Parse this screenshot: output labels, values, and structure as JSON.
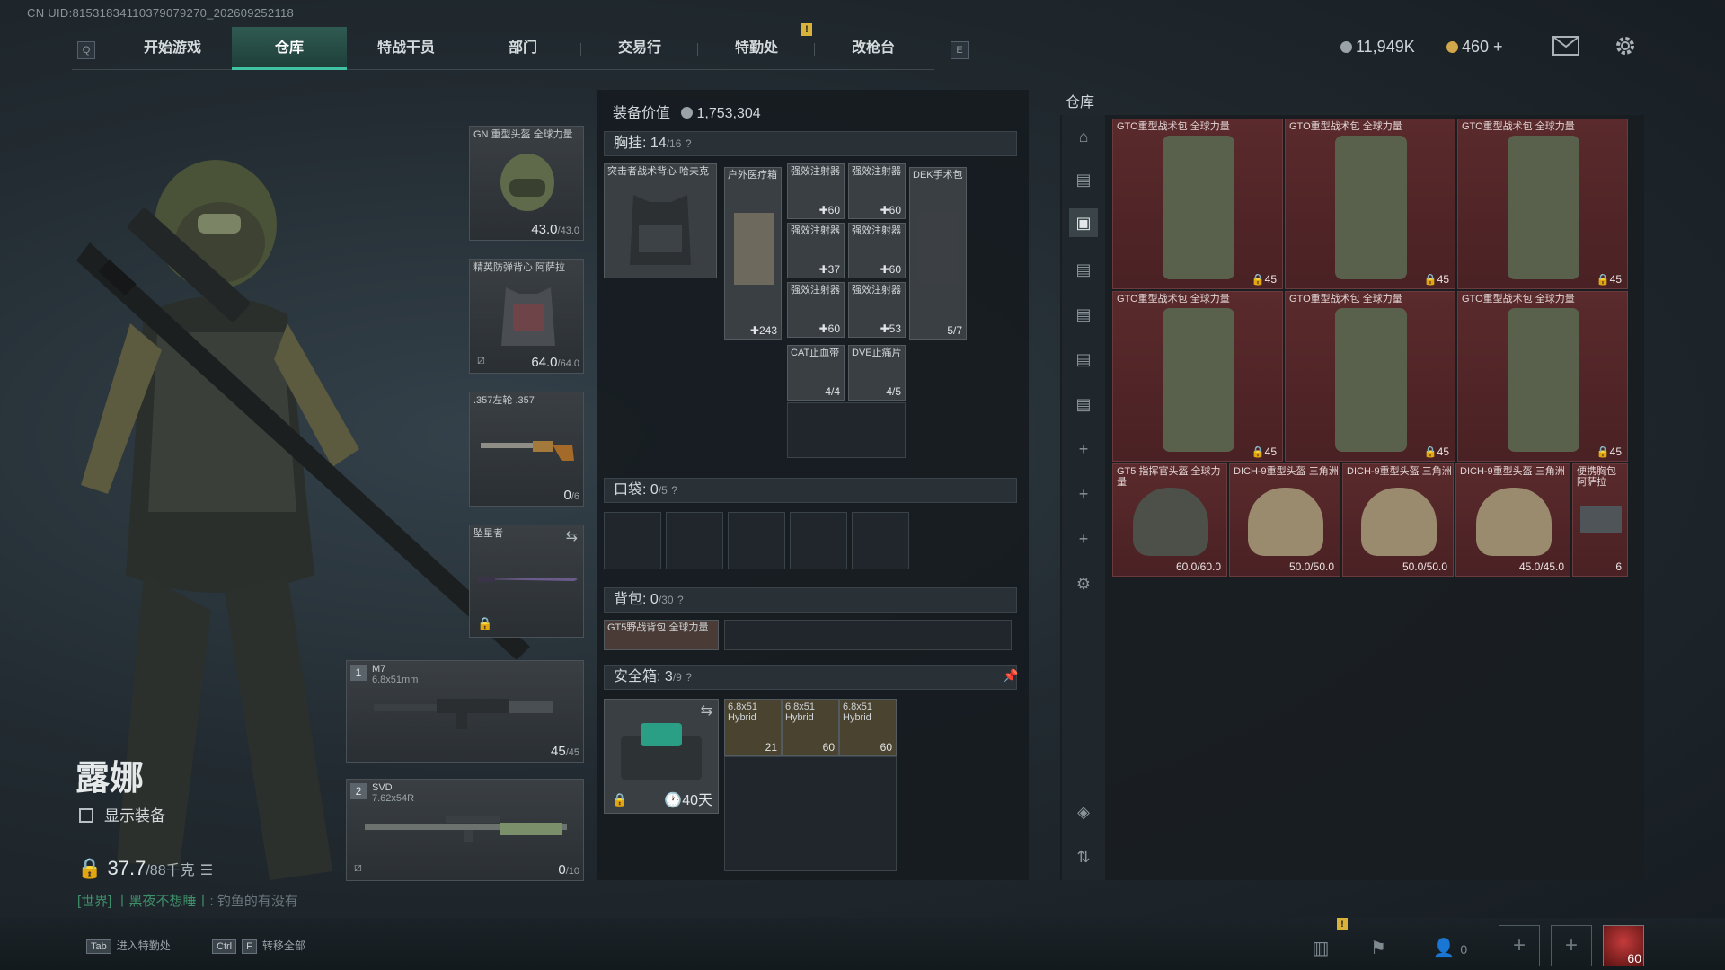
{
  "header": {
    "uid": "CN UID:8153183411037907927​0_202609252118",
    "tabs": [
      "开始游戏",
      "仓库",
      "特战干员",
      "部门",
      "交易行",
      "特勤处",
      "改枪台"
    ],
    "active_tab": "仓库",
    "key_left": "Q",
    "key_right": "E",
    "warning_mark": "!",
    "currency_silver": "11,949K",
    "currency_gold": "460 +",
    "mail_icon": "mail-icon",
    "settings_icon": "gear-icon"
  },
  "character": {
    "name": "露娜",
    "show_equipment": "显示装备",
    "weight": "37.7",
    "weight_max": "/88千克",
    "chat_channel": "[世界]",
    "chat_user": "丨黑夜不想睡丨:",
    "chat_text": "钓鱼的有没有"
  },
  "gear_slots": {
    "helmet": {
      "label": "GN 重型头盔 全球力量",
      "value": "43.0",
      "max": "/43.0"
    },
    "armor": {
      "label": "精英防弹背心 阿萨拉",
      "value": "64.0",
      "max": "/64.0"
    },
    "pistol": {
      "label": ".357左轮 .357",
      "value": "0",
      "max": "/6"
    },
    "melee": {
      "label": "坠星者"
    },
    "primary1": {
      "index": "1",
      "name": "M7",
      "ammo": "6.8x51mm",
      "value": "45",
      "max": "/45"
    },
    "primary2": {
      "index": "2",
      "name": "SVD",
      "ammo": "7.62x54R",
      "value": "0",
      "max": "/10"
    }
  },
  "equipment": {
    "title": "装备价值",
    "value": "1,753,304",
    "chest_rig": {
      "label": "胸挂:",
      "count": "14",
      "max": "/16",
      "help": "?"
    },
    "rig_item": "突击者战术背心 哈夫克",
    "rig_cells": [
      {
        "label": "户外医疗箱",
        "num": "243"
      },
      {
        "label": "强效注射器",
        "num": "60"
      },
      {
        "label": "强效注射器",
        "num": "60"
      },
      {
        "label": "强效注射器",
        "num": "37"
      },
      {
        "label": "强效注射器",
        "num": "60"
      },
      {
        "label": "强效注射器",
        "num": "60"
      },
      {
        "label": "强效注射器",
        "num": "53"
      },
      {
        "label": "DEK手术包",
        "num": "5/7"
      },
      {
        "label": "CAT止血带",
        "num": "4/4"
      },
      {
        "label": "DVE止痛片",
        "num": "4/5"
      }
    ],
    "pocket": {
      "label": "口袋:",
      "count": "0",
      "max": "/5",
      "help": "?"
    },
    "backpack": {
      "label": "背包:",
      "count": "0",
      "max": "/30",
      "help": "?"
    },
    "backpack_item": "GT5野战背包 全球力量",
    "safebox": {
      "label": "安全箱:",
      "count": "3",
      "max": "/9",
      "help": "?",
      "timer": "40天"
    },
    "safebox_cells": [
      {
        "label": "6.8x51 Hybrid",
        "num": "21"
      },
      {
        "label": "6.8x51 Hybrid",
        "num": "60"
      },
      {
        "label": "6.8x51 Hybrid",
        "num": "60"
      }
    ]
  },
  "warehouse": {
    "title": "仓库",
    "items": [
      {
        "label": "GTO重型战术包 全球力量",
        "num": "45"
      },
      {
        "label": "GTO重型战术包 全球力量",
        "num": "45"
      },
      {
        "label": "GTO重型战术包 全球力量",
        "num": "45"
      },
      {
        "label": "GTO重型战术包 全球力量",
        "num": "45"
      },
      {
        "label": "GTO重型战术包 全球力量",
        "num": "45"
      },
      {
        "label": "GTO重型战术包 全球力量",
        "num": "45"
      },
      {
        "label": "GT5 指挥官头盔 全球力量",
        "num": "60.0/60.0"
      },
      {
        "label": "DICH-9重型头盔 三角洲",
        "num": "50.0/50.0"
      },
      {
        "label": "DICH-9重型头盔 三角洲",
        "num": "50.0/50.0"
      },
      {
        "label": "DICH-9重型头盔 三角洲",
        "num": "45.0/45.0"
      },
      {
        "label": "便携胸包 阿萨拉",
        "num": "6"
      }
    ]
  },
  "bottom": {
    "hint1_key": "Tab",
    "hint1": "进入特勤处",
    "hint2_key1": "Ctrl",
    "hint2_key2": "F",
    "hint2": "转移全部",
    "friends_count": "0",
    "level": "60"
  }
}
